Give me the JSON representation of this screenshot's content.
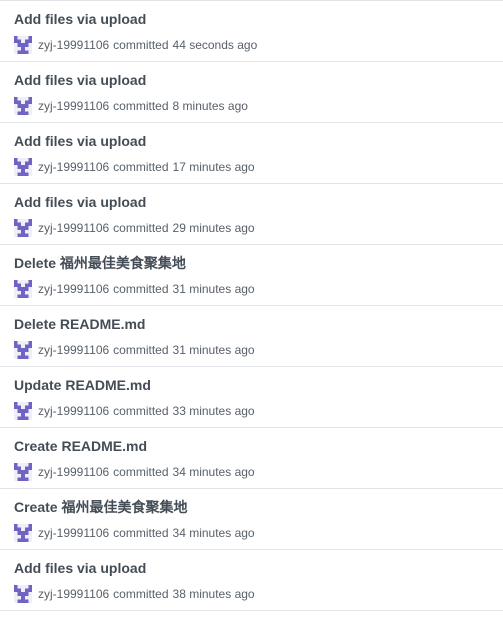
{
  "commits": [
    {
      "message": "Add files via upload",
      "author": "zyj-19991106",
      "action": "committed",
      "time": "44 seconds ago"
    },
    {
      "message": "Add files via upload",
      "author": "zyj-19991106",
      "action": "committed",
      "time": "8 minutes ago"
    },
    {
      "message": "Add files via upload",
      "author": "zyj-19991106",
      "action": "committed",
      "time": "17 minutes ago"
    },
    {
      "message": "Add files via upload",
      "author": "zyj-19991106",
      "action": "committed",
      "time": "29 minutes ago"
    },
    {
      "message": "Delete 福州最佳美食聚集地",
      "author": "zyj-19991106",
      "action": "committed",
      "time": "31 minutes ago"
    },
    {
      "message": "Delete README.md",
      "author": "zyj-19991106",
      "action": "committed",
      "time": "31 minutes ago"
    },
    {
      "message": "Update README.md",
      "author": "zyj-19991106",
      "action": "committed",
      "time": "33 minutes ago"
    },
    {
      "message": "Create README.md",
      "author": "zyj-19991106",
      "action": "committed",
      "time": "34 minutes ago"
    },
    {
      "message": "Create 福州最佳美食聚集地",
      "author": "zyj-19991106",
      "action": "committed",
      "time": "34 minutes ago"
    },
    {
      "message": "Add files via upload",
      "author": "zyj-19991106",
      "action": "committed",
      "time": "38 minutes ago"
    }
  ],
  "avatar": {
    "icon": "identicon-avatar-icon",
    "color": "#6f63c4"
  },
  "colors": {
    "title": "#444d56",
    "meta": "#586069",
    "border": "#e1e4e8"
  }
}
